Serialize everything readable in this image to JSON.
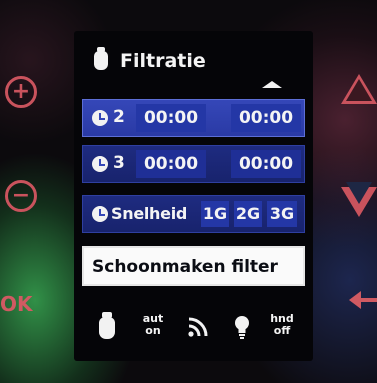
{
  "side_controls": {
    "plus": "+",
    "minus": "−",
    "ok": "OK"
  },
  "screen": {
    "title": "Filtratie",
    "rows": [
      {
        "number": "2",
        "start": "00:00",
        "end": "00:00"
      },
      {
        "number": "3",
        "start": "00:00",
        "end": "00:00"
      }
    ],
    "speed": {
      "label": "Snelheid",
      "options": [
        "1G",
        "2G",
        "3G"
      ]
    },
    "clean_filter_label": "Schoonmaken filter",
    "bottom": {
      "auto_line1": "aut",
      "auto_line2": "on",
      "hand_line1": "hnd",
      "hand_line2": "off"
    }
  },
  "colors": {
    "row_active": "#3547b8",
    "row_dim": "#1e2b80",
    "side_button": "#c9535d",
    "screen_bg": "#050508"
  },
  "icons": [
    "pump-icon",
    "clock-icon",
    "wifi-icon",
    "bulb-icon",
    "scroll-up-icon"
  ]
}
